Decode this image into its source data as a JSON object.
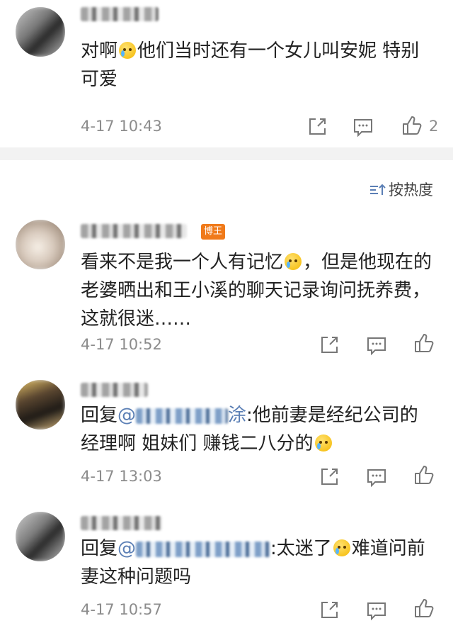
{
  "comments": [
    {
      "text_before_emoji": "对啊",
      "text_after_emoji": "他们当时还有一个女儿叫安妮 特别可爱",
      "time": "4-17 10:43",
      "likes": "2"
    },
    {
      "badge": "博王",
      "text_before_emoji": "看来不是我一个人有记忆",
      "text_after_emoji": "，但是他现在的老婆晒出和王小溪的聊天记录询问抚养费，这就很迷……",
      "time": "4-17 10:52"
    },
    {
      "reply_prefix": "回复",
      "mention_at": "@",
      "mention_tail": "涂",
      "text": ":他前妻是经纪公司的经理啊 姐妹们 赚钱二八分的",
      "time": "4-17 13:03"
    },
    {
      "reply_prefix": "回复",
      "mention_at": "@",
      "text_before_emoji": ":太迷了",
      "text_after_emoji": "难道问前妻这种问题吗",
      "time": "4-17 10:57"
    }
  ],
  "sort": {
    "label": "按热度"
  },
  "icons": {
    "share": "share-icon",
    "comment": "comment-icon",
    "like": "thumbs-up-icon",
    "sort": "sort-icon",
    "emoji": "crying-emoji-icon"
  },
  "colors": {
    "mention": "#5b7fb5",
    "badge": "#f07a1a",
    "meta": "#8c8c8c",
    "divider": "#f2f2f2"
  }
}
